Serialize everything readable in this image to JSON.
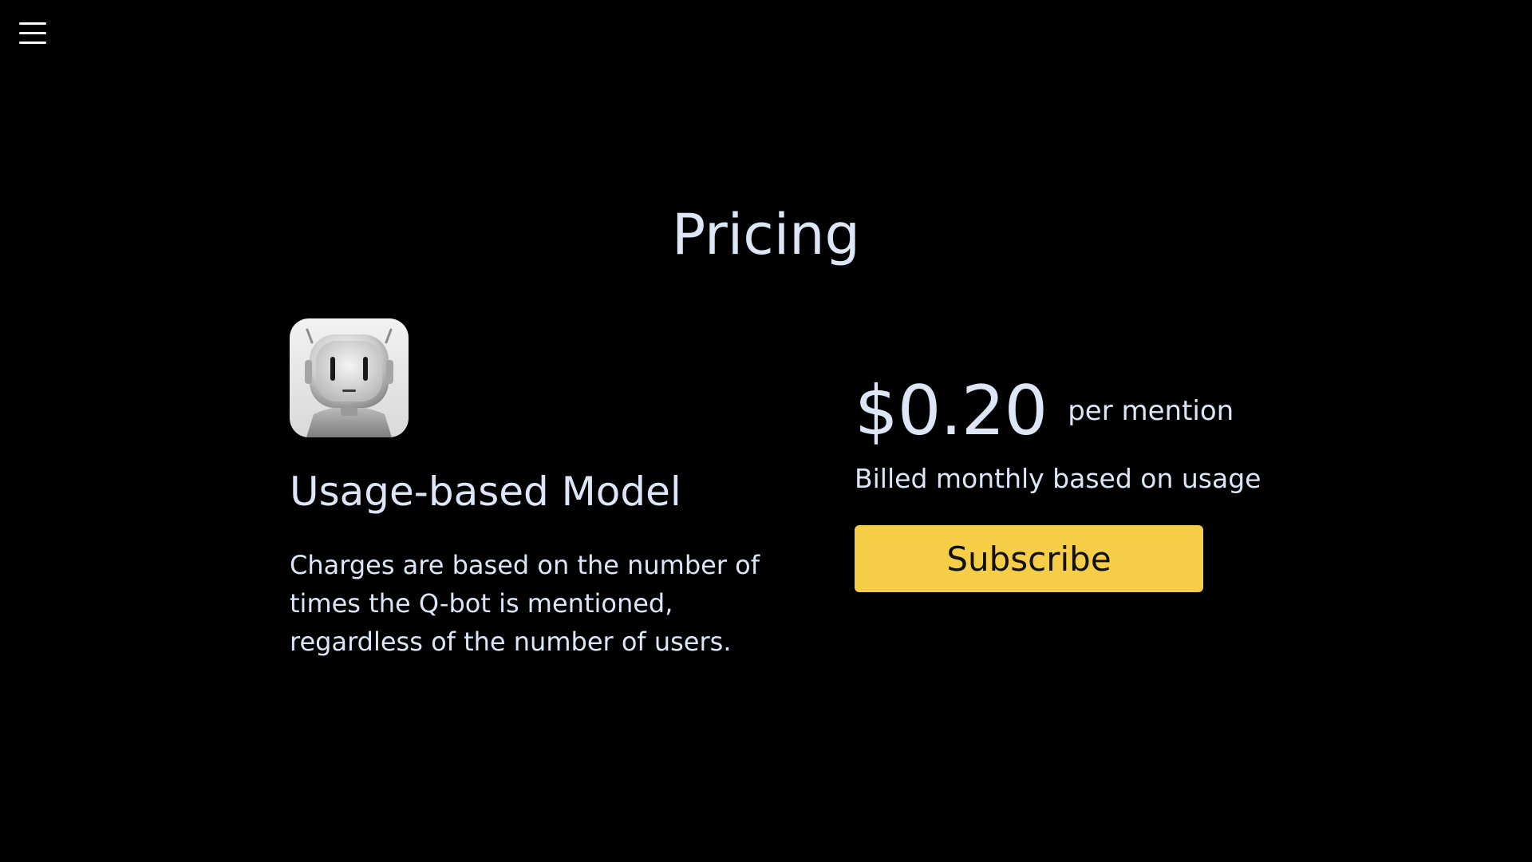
{
  "header": {
    "menu_icon": "hamburger-menu-icon"
  },
  "page": {
    "title": "Pricing"
  },
  "plan": {
    "avatar_icon": "robot-avatar",
    "name": "Usage-based Model",
    "description": "Charges are based on the number of times the Q-bot is mentioned, regardless of the number of users."
  },
  "pricing": {
    "amount": "$0.20",
    "unit": "per mention",
    "billing_note": "Billed monthly based on usage",
    "subscribe_label": "Subscribe"
  },
  "colors": {
    "background": "#000000",
    "text": "#dde6f7",
    "accent": "#f5cd47"
  }
}
